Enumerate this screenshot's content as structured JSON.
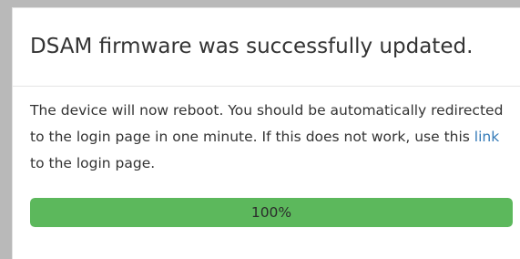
{
  "dialog": {
    "title": "DSAM firmware was successfully updated.",
    "message_before_link": "The device will now reboot. You should be automatically redirected to the login page in one minute. If this does not work, use this ",
    "link_text": "link",
    "message_after_link": " to the login page."
  },
  "progress": {
    "value_percent": 100,
    "label": "100%"
  },
  "colors": {
    "progress_fill": "#5cb85c",
    "link": "#337ab7",
    "text": "#333333"
  }
}
